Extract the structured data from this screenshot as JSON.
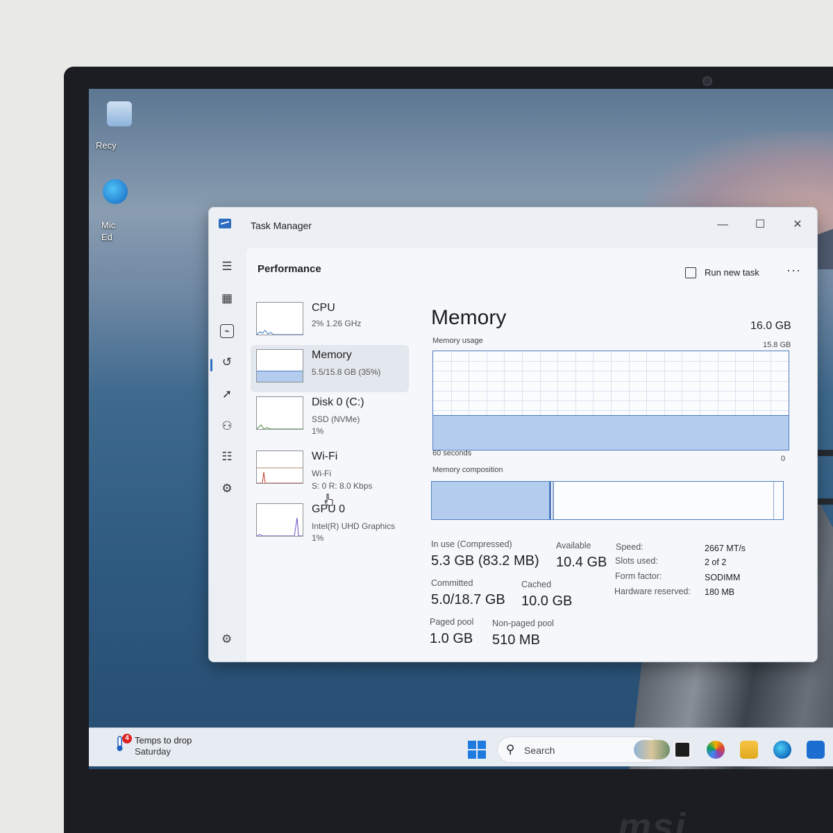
{
  "desktop": {
    "icons": [
      {
        "label": "Recy"
      },
      {
        "label": "Mic\nEd"
      }
    ]
  },
  "window": {
    "title": "Task Manager",
    "controls": {
      "minimize": "—",
      "maximize": "☐",
      "close": "✕"
    }
  },
  "nav_rail": {
    "items": [
      {
        "name": "hamburger-menu",
        "glyph": "☰"
      },
      {
        "name": "processes",
        "glyph": "▦"
      },
      {
        "name": "performance",
        "glyph": "⌁"
      },
      {
        "name": "app-history",
        "glyph": "↺"
      },
      {
        "name": "startup-apps",
        "glyph": "➚"
      },
      {
        "name": "users",
        "glyph": "⚇"
      },
      {
        "name": "details",
        "glyph": "☷"
      },
      {
        "name": "services",
        "glyph": "⚙"
      }
    ],
    "settings_glyph": "⚙"
  },
  "toolbar": {
    "section": "Performance",
    "run_new_task": "Run new task",
    "more": "···"
  },
  "devices": [
    {
      "name": "CPU",
      "line1": "2%  1.26 GHz",
      "line2": ""
    },
    {
      "name": "Memory",
      "line1": "5.5/15.8 GB (35%)",
      "line2": ""
    },
    {
      "name": "Disk 0 (C:)",
      "line1": "SSD (NVMe)",
      "line2": "1%"
    },
    {
      "name": "Wi-Fi",
      "line1": "Wi-Fi",
      "line2": "S: 0  R: 8.0 Kbps"
    },
    {
      "name": "GPU 0",
      "line1": "Intel(R) UHD Graphics",
      "line2": "1%"
    }
  ],
  "detail": {
    "title": "Memory",
    "total": "16.0 GB",
    "usage_label": "Memory usage",
    "usage_max": "15.8 GB",
    "usage_fraction": 0.35,
    "time_span": "60 seconds",
    "axis_min": "0",
    "composition_label": "Memory composition",
    "composition_in_use_fraction": 0.34,
    "stats": {
      "in_use_label": "In use (Compressed)",
      "in_use_value": "5.3 GB (83.2 MB)",
      "available_label": "Available",
      "available_value": "10.4 GB",
      "committed_label": "Committed",
      "committed_value": "5.0/18.7 GB",
      "cached_label": "Cached",
      "cached_value": "10.0 GB",
      "paged_label": "Paged pool",
      "paged_value": "1.0 GB",
      "nonpaged_label": "Non-paged pool",
      "nonpaged_value": "510 MB"
    },
    "specs": {
      "speed_label": "Speed:",
      "speed_value": "2667 MT/s",
      "slots_label": "Slots used:",
      "slots_value": "2 of 2",
      "form_label": "Form factor:",
      "form_value": "SODIMM",
      "reserved_label": "Hardware reserved:",
      "reserved_value": "180 MB"
    }
  },
  "taskbar": {
    "weather_title": "Temps to drop",
    "weather_sub": "Saturday",
    "weather_badge": "4",
    "search_placeholder": "Search"
  },
  "colors": {
    "accent": "#2d6cc0",
    "graph_fill": "#b4cdee",
    "graph_line": "#4f7cc0"
  },
  "brand": "msi"
}
